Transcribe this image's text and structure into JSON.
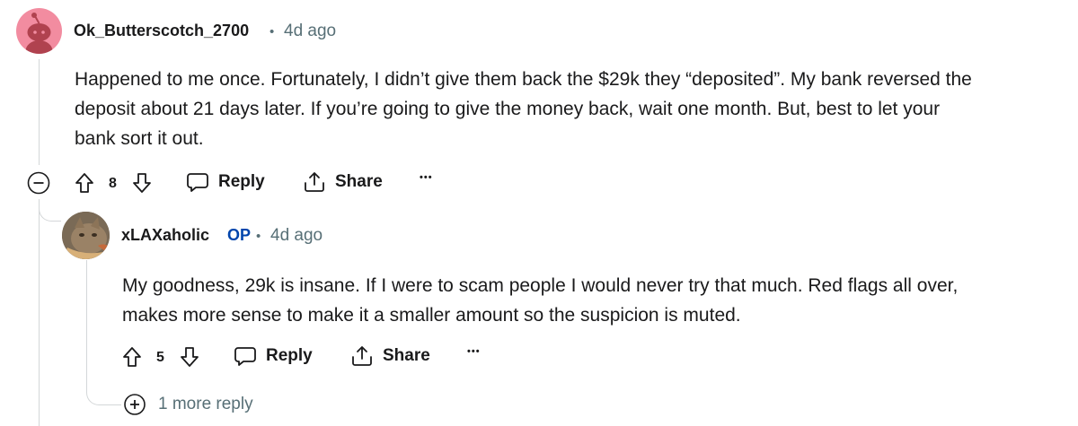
{
  "comment1": {
    "username": "Ok_Butterscotch_2700",
    "separator": "•",
    "time": "4d ago",
    "body_line1": "Happened to me once. Fortunately, I didn’t give them back the $29k they “deposited”. My bank reversed the",
    "body_line2": "deposit about 21 days later. If you’re going to give the money back, wait one month. But, best to let your",
    "body_line3": "bank sort it out.",
    "votes": "8",
    "reply_label": "Reply",
    "share_label": "Share",
    "more_label": "•••"
  },
  "comment2": {
    "username": "xLAXaholic",
    "op_badge": "OP",
    "separator": "•",
    "time": "4d ago",
    "body_line1": "My goodness, 29k is insane. If I were to scam people I would never try that much. Red flags all over,",
    "body_line2": "makes more sense to make it a smaller amount so the suspicion is muted.",
    "votes": "5",
    "reply_label": "Reply",
    "share_label": "Share",
    "more_label": "•••",
    "more_replies": "1 more reply"
  },
  "colors": {
    "avatar1_bg": "#f28ca0",
    "op_blue": "#0045ac",
    "meta_gray": "#576f76",
    "thread_line": "#d4d7d9"
  }
}
